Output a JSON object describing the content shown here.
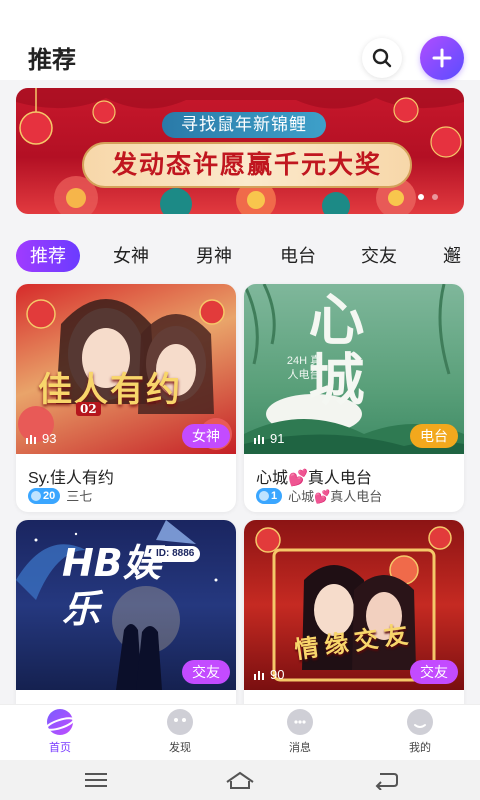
{
  "header": {
    "title": "推荐"
  },
  "banner": {
    "top_text": "寻找鼠年新锦鲤",
    "main_text": "发动态许愿赢千元大奖"
  },
  "tabs": [
    "推荐",
    "女神",
    "男神",
    "电台",
    "交友",
    "邂"
  ],
  "cards": [
    {
      "art_text": "佳人有约",
      "art_sub": "02",
      "count": "93",
      "tag": "女神",
      "tag_color": "#c34bff",
      "title": "Sy.佳人有约",
      "level": "20",
      "host": "三七"
    },
    {
      "art_text": "心城",
      "art_sub": "24H 真人电台",
      "count": "91",
      "tag": "电台",
      "tag_color": "#f2a81d",
      "title": "心城💕真人电台",
      "level": "1",
      "host": "心城💕真人电台"
    },
    {
      "art_text": "HB娱乐",
      "art_sub": "ID: 8886",
      "count": "",
      "tag": "交友",
      "tag_color": "#c34bff",
      "title": "",
      "level": "",
      "host": ""
    },
    {
      "art_text": "情缘交友",
      "art_sub": "",
      "count": "90",
      "tag": "交友",
      "tag_color": "#c34bff",
      "title": "",
      "level": "",
      "host": ""
    }
  ],
  "bottom_nav": [
    {
      "label": "首页",
      "active": true
    },
    {
      "label": "发现",
      "active": false
    },
    {
      "label": "消息",
      "active": false
    },
    {
      "label": "我的",
      "active": false
    }
  ]
}
